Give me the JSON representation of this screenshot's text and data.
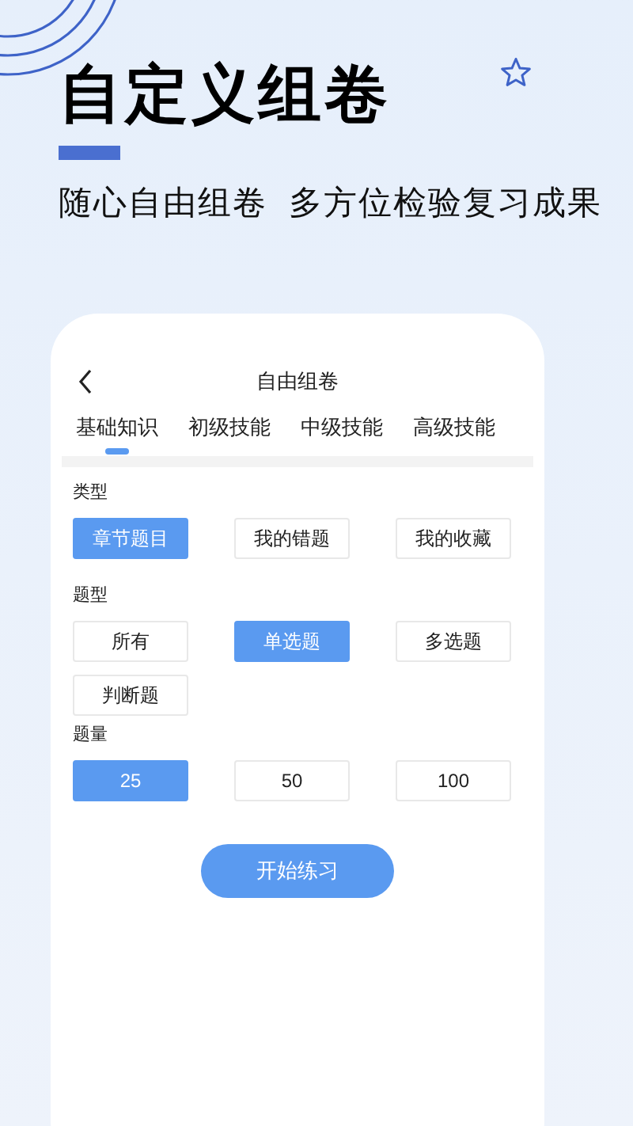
{
  "headline": "自定义组卷",
  "subtitle": "随心自由组卷  多方位检验复习成果",
  "screen": {
    "title": "自由组卷",
    "tabs": [
      {
        "label": "基础知识",
        "selected": true
      },
      {
        "label": "初级技能",
        "selected": false
      },
      {
        "label": "中级技能",
        "selected": false
      },
      {
        "label": "高级技能",
        "selected": false
      }
    ],
    "sections": [
      {
        "label": "类型",
        "options": [
          {
            "label": "章节题目",
            "selected": true
          },
          {
            "label": "我的错题",
            "selected": false
          },
          {
            "label": "我的收藏",
            "selected": false
          }
        ]
      },
      {
        "label": "题型",
        "options": [
          {
            "label": "所有",
            "selected": false
          },
          {
            "label": "单选题",
            "selected": true
          },
          {
            "label": "多选题",
            "selected": false
          },
          {
            "label": "判断题",
            "selected": false
          }
        ]
      },
      {
        "label": "题量",
        "options": [
          {
            "label": "25",
            "selected": true
          },
          {
            "label": "50",
            "selected": false
          },
          {
            "label": "100",
            "selected": false
          }
        ]
      }
    ],
    "start_button": "开始练习"
  }
}
